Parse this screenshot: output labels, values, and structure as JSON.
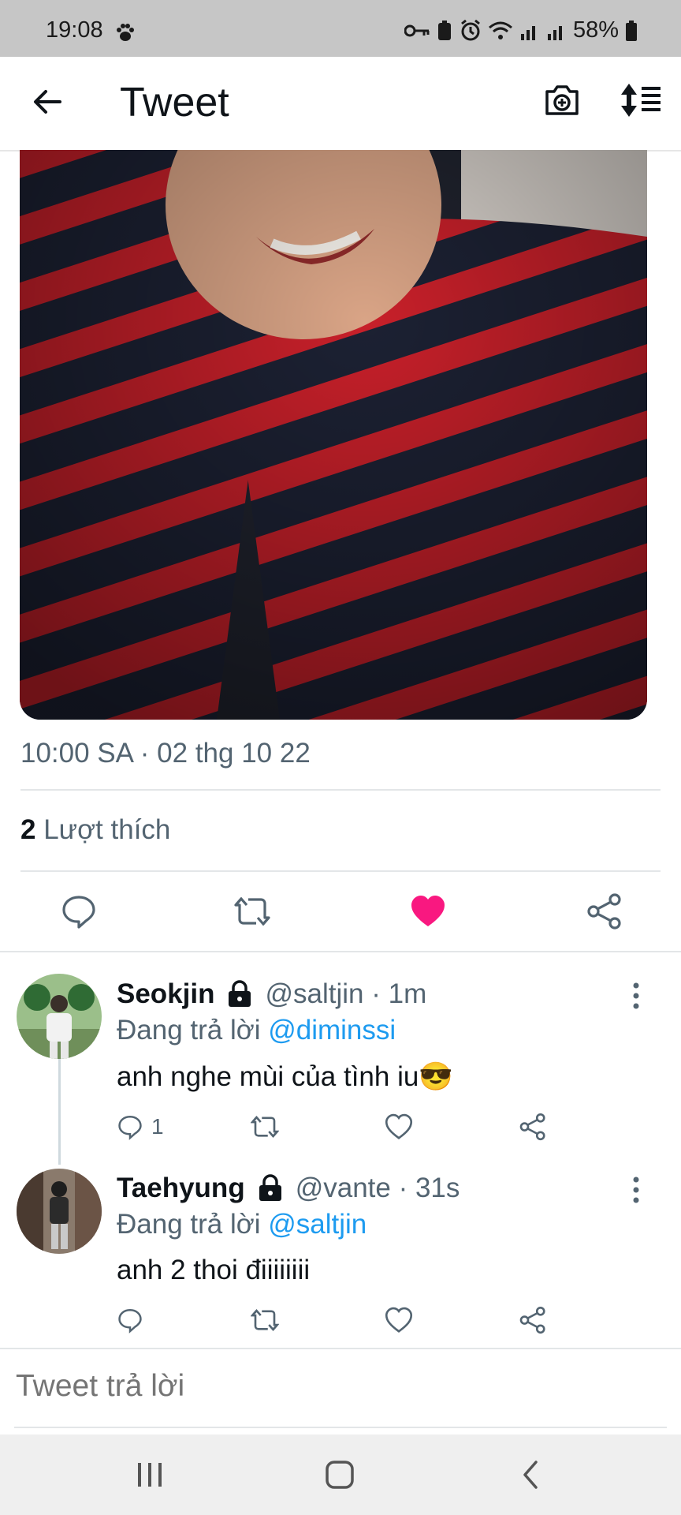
{
  "status": {
    "time": "19:08",
    "battery": "58%"
  },
  "header": {
    "title": "Tweet"
  },
  "tweet": {
    "timestamp": "10:00 SA · 02 thg 10 22",
    "likes_count": "2",
    "likes_label": "Lượt thích",
    "liked": true
  },
  "replies": [
    {
      "name": "Seokjin",
      "handle": "@saltjin · 1m",
      "replying_prefix": "Đang trả lời",
      "replying_to": "@diminssi",
      "text": "anh nghe mùi của tình iu😎",
      "reply_count": "1"
    },
    {
      "name": "Taehyung",
      "handle": "@vante · 31s",
      "replying_prefix": "Đang trả lời",
      "replying_to": "@saltjin",
      "text": "anh 2 thoi điiiiiiii",
      "reply_count": ""
    }
  ],
  "compose": {
    "placeholder": "Tweet trả lời"
  },
  "colors": {
    "like": "#f91880",
    "mention": "#1d9bf0",
    "secondary_text": "#536471"
  }
}
